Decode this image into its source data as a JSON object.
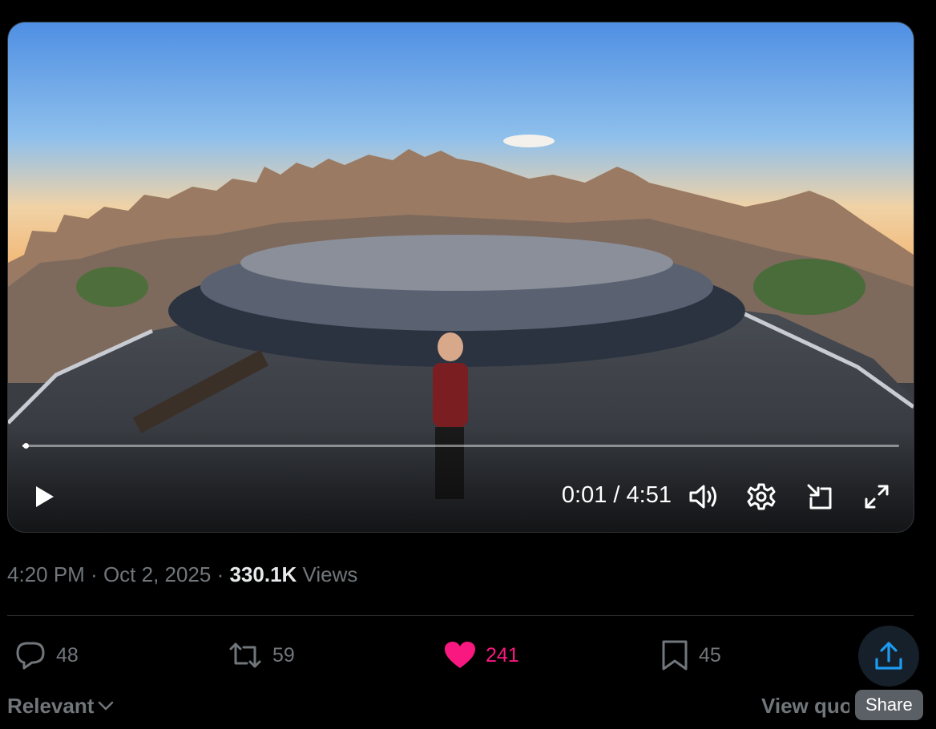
{
  "video": {
    "current_time": "0:01",
    "time_separator": " / ",
    "duration": "4:51",
    "progress": 0.0034
  },
  "post": {
    "time": "4:20 PM",
    "separator": " · ",
    "date": "Oct 2, 2025",
    "views_count": "330.1K",
    "views_label": " Views"
  },
  "actions": {
    "replies": "48",
    "reposts": "59",
    "likes": "241",
    "bookmarks": "45"
  },
  "colors": {
    "like": "#f91880",
    "share": "#1d9bf0",
    "muted": "#71767b"
  },
  "footer": {
    "sort_label": "Relevant",
    "view_quotes": "View quotes",
    "share_tooltip": "Share"
  }
}
